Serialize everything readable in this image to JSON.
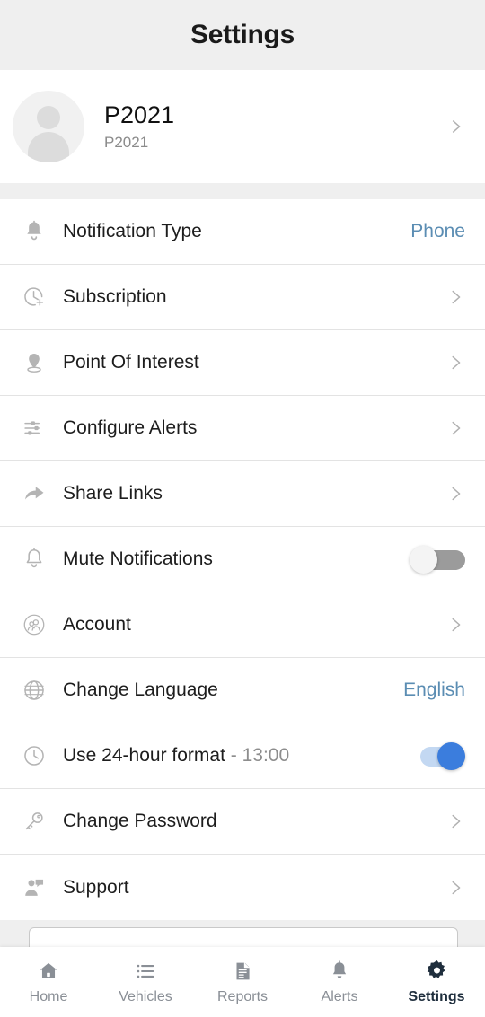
{
  "header": {
    "title": "Settings"
  },
  "profile": {
    "name": "P2021",
    "subtitle": "P2021",
    "avatar_icon": "person-avatar-icon",
    "chevron_icon": "chevron-right-icon"
  },
  "settings_rows": [
    {
      "label": "Notification Type",
      "icon": "bell-filled-icon",
      "accessory": "value",
      "value": "Phone"
    },
    {
      "label": "Subscription",
      "icon": "clock-plus-icon",
      "accessory": "chevron"
    },
    {
      "label": "Point Of Interest",
      "icon": "location-pin-icon",
      "accessory": "chevron"
    },
    {
      "label": "Configure Alerts",
      "icon": "sliders-icon",
      "accessory": "chevron"
    },
    {
      "label": "Share Links",
      "icon": "share-arrow-icon",
      "accessory": "chevron"
    },
    {
      "label": "Mute Notifications",
      "icon": "bell-outline-icon",
      "accessory": "toggle",
      "toggle_state": "off"
    },
    {
      "label": "Account",
      "icon": "people-circle-icon",
      "accessory": "chevron"
    },
    {
      "label": "Change Language",
      "icon": "globe-icon",
      "accessory": "value",
      "value": "English"
    },
    {
      "label": "Use 24-hour format",
      "suffix": " - 13:00",
      "icon": "clock-icon",
      "accessory": "toggle",
      "toggle_state": "on"
    },
    {
      "label": "Change Password",
      "icon": "key-icon",
      "accessory": "chevron"
    },
    {
      "label": "Support",
      "icon": "support-agent-icon",
      "accessory": "chevron"
    }
  ],
  "bottom_nav": {
    "items": [
      {
        "label": "Home",
        "icon": "home-icon",
        "active": false
      },
      {
        "label": "Vehicles",
        "icon": "list-icon",
        "active": false
      },
      {
        "label": "Reports",
        "icon": "document-icon",
        "active": false
      },
      {
        "label": "Alerts",
        "icon": "bell-icon",
        "active": false
      },
      {
        "label": "Settings",
        "icon": "gear-icon",
        "active": true
      }
    ]
  },
  "colors": {
    "accent_value": "#5b8db3",
    "toggle_on": "#3b7ddd",
    "toggle_off": "#9b9b9b",
    "nav_active": "#1f2e3d",
    "nav_inactive": "#8a8f96",
    "page_background": "#efefef"
  }
}
